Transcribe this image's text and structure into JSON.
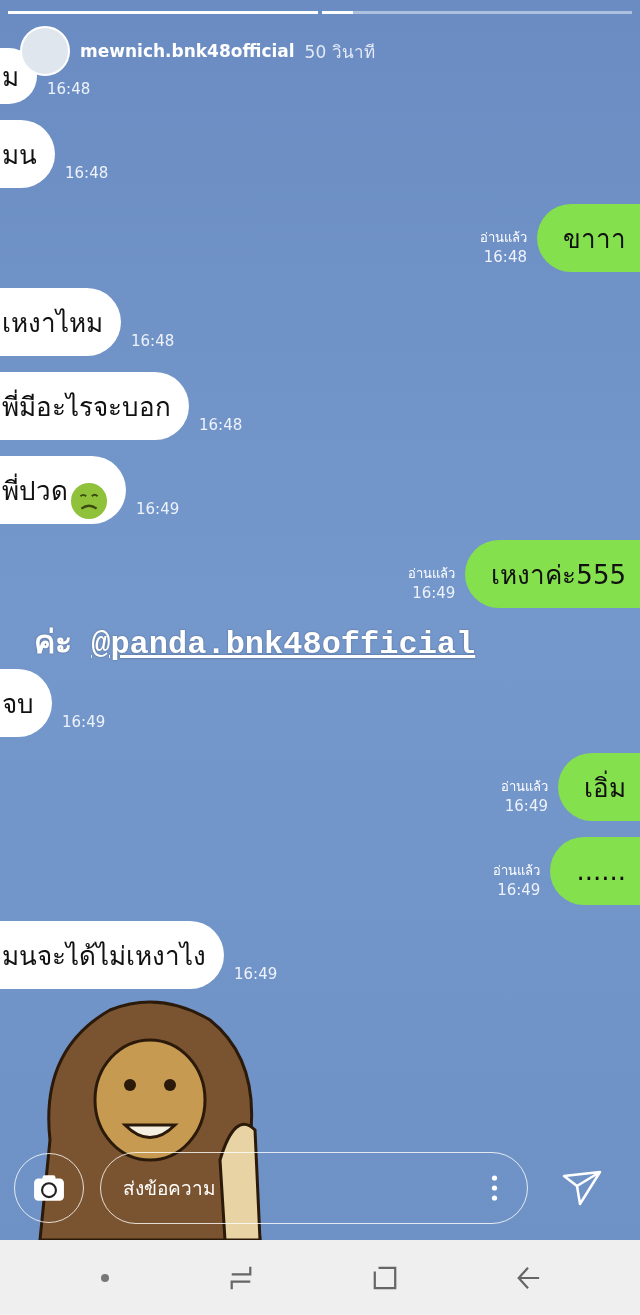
{
  "story": {
    "segments": [
      {
        "level": 1
      },
      {
        "level": 0.1
      }
    ],
    "username": "mewnich.bnk48official",
    "age": "50 วินาที"
  },
  "messages": [
    {
      "kind": "incoming",
      "text": "ม",
      "time": "16:48",
      "emoji": false
    },
    {
      "kind": "incoming",
      "text": "มน",
      "time": "16:48",
      "emoji": false
    },
    {
      "kind": "outgoing",
      "text": "ขาาา",
      "time": "16:48",
      "read": "อ่านแล้ว",
      "emoji": false
    },
    {
      "kind": "incoming",
      "text": "เหงาไหม",
      "time": "16:48",
      "emoji": false
    },
    {
      "kind": "incoming",
      "text": "พี่มีอะไรจะบอก",
      "time": "16:48",
      "emoji": false
    },
    {
      "kind": "incoming",
      "text": "พี่ปวด",
      "time": "16:49",
      "emoji": true
    },
    {
      "kind": "outgoing",
      "text": "เหงาค่ะ555",
      "time": "16:49",
      "read": "อ่านแล้ว",
      "emoji": false
    },
    {
      "kind": "mention",
      "text": "ค่ะ",
      "handle": "@panda.bnk48official"
    },
    {
      "kind": "incoming",
      "text": "จบ",
      "time": "16:49",
      "emoji": false
    },
    {
      "kind": "outgoing",
      "text": "เอิ่ม",
      "time": "16:49",
      "read": "อ่านแล้ว",
      "emoji": false
    },
    {
      "kind": "outgoing",
      "text": "......",
      "time": "16:49",
      "read": "อ่านแล้ว",
      "emoji": false
    },
    {
      "kind": "incoming",
      "text": "มนจะได้ไม่เหงาไง",
      "time": "16:49",
      "emoji": false
    }
  ],
  "reply": {
    "placeholder": "ส่งข้อความ"
  }
}
